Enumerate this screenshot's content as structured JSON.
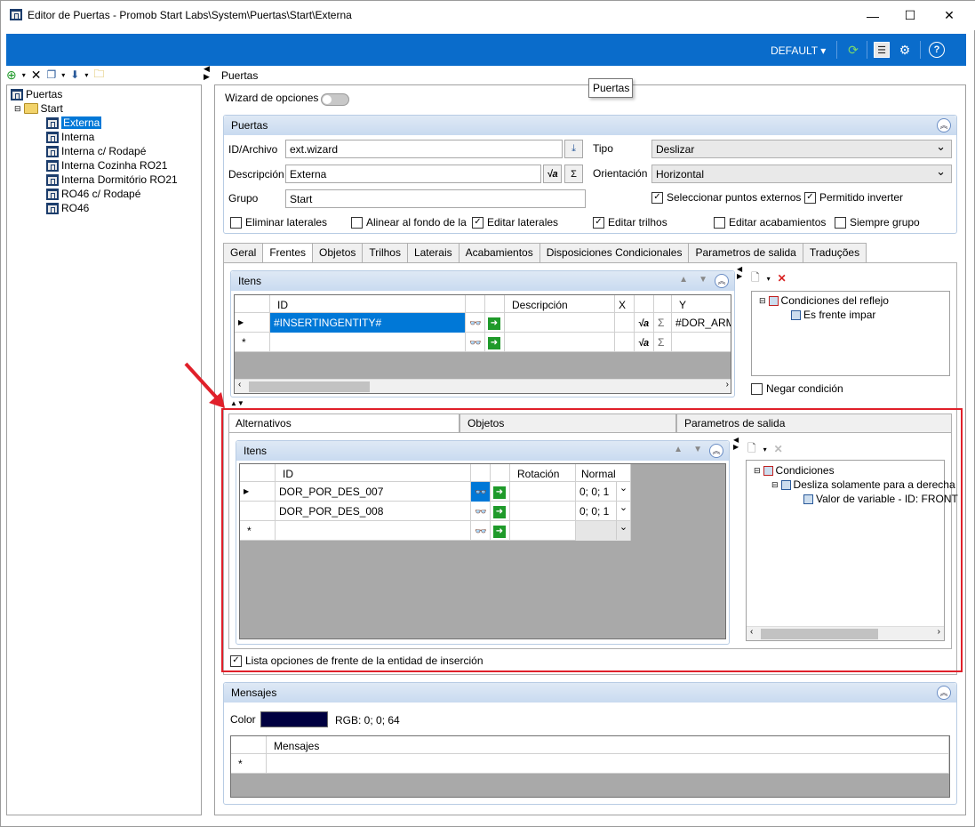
{
  "window": {
    "title": "Editor de Puertas - Promob Start Labs\\System\\Puertas\\Start\\Externa",
    "minimize": "—",
    "maximize": "☐",
    "close": "✕"
  },
  "topbar": {
    "profile": "DEFAULT",
    "bg_color": "#0a6ccb"
  },
  "tree": {
    "root": "Puertas",
    "folder": "Start",
    "items": [
      "Externa",
      "Interna",
      "Interna c/ Rodapé",
      "Interna Cozinha RO21",
      "Interna Dormitório RO21",
      "RO46 c/ Rodapé",
      "RO46"
    ],
    "selected": "Externa"
  },
  "breadcrumb": "Puertas",
  "tooltip": "Puertas",
  "wizard_label": "Wizard de opciones",
  "puertas_group": {
    "header": "Puertas",
    "id_label": "ID/Archivo",
    "id_value": "ext.wizard",
    "desc_label": "Descripción",
    "desc_value": "Externa",
    "grupo_label": "Grupo",
    "grupo_value": "Start",
    "tipo_label": "Tipo",
    "tipo_value": "Deslizar",
    "orient_label": "Orientación",
    "orient_value": "Horizontal",
    "chk_sel_puntos": "Seleccionar puntos externos",
    "chk_perm_inv": "Permitido inverter",
    "chk_elim_lat": "Eliminar laterales",
    "chk_alinear": "Alinear al fondo de la",
    "chk_edit_lat": "Editar laterales",
    "chk_edit_trilhos": "Editar trilhos",
    "chk_edit_acab": "Editar acabamientos",
    "chk_siempre": "Siempre grupo"
  },
  "tabs": [
    "Geral",
    "Frentes",
    "Objetos",
    "Trilhos",
    "Laterais",
    "Acabamientos",
    "Disposiciones Condicionales",
    "Parametros de salida",
    "Traduções"
  ],
  "frentes": {
    "itens_header": "Itens",
    "columns": [
      "ID",
      "Descripción",
      "X",
      "Y"
    ],
    "row1_id": "#INSERTINGENTITY#",
    "row1_y": "#DOR_ARM_",
    "sigma": "Σ",
    "cond_root": "Condiciones del reflejo",
    "cond_child": "Es frente impar",
    "negar": "Negar condición"
  },
  "subtabs": [
    "Alternativos",
    "Objetos",
    "Parametros de salida"
  ],
  "alternativos": {
    "itens_header": "Itens",
    "columns": [
      "ID",
      "Rotación",
      "Normal"
    ],
    "rows": [
      {
        "id": "DOR_POR_DES_007",
        "normal": "0; 0; 1"
      },
      {
        "id": "DOR_POR_DES_008",
        "normal": "0; 0; 1"
      }
    ],
    "cond_root": "Condiciones",
    "cond_child": "Desliza solamente para a derecha",
    "cond_grand": "Valor de variable - ID: FRONT"
  },
  "lista_opciones": "Lista opciones de frente de la entidad de inserción",
  "mensajes": {
    "header": "Mensajes",
    "color_label": "Color",
    "color_value": "#000040",
    "rgb_text": "RGB: 0; 0; 64",
    "col_header": "Mensajes"
  },
  "marks": {
    "new_row": "*",
    "current_row": "▶",
    "check": "✓",
    "binoc": "🔭"
  }
}
